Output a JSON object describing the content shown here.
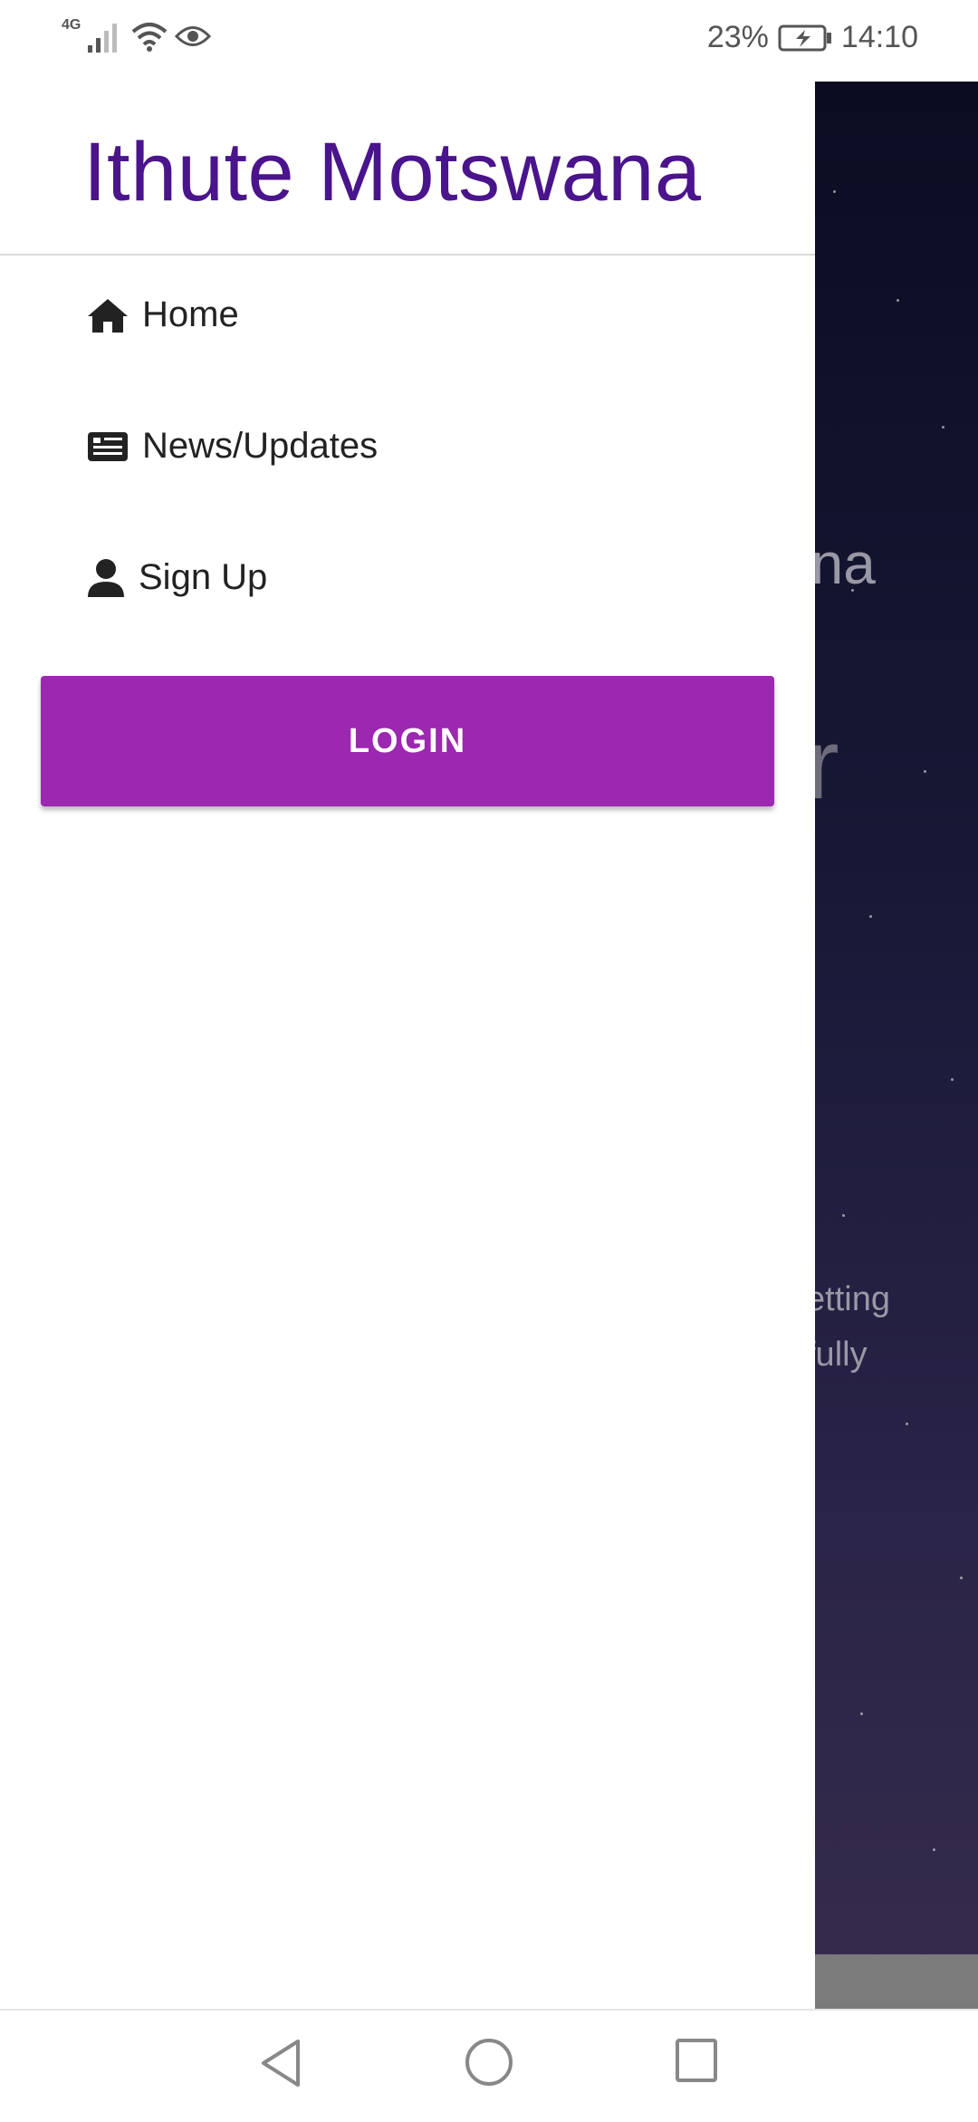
{
  "status_bar": {
    "network": "4G",
    "battery": "23%",
    "time": "14:10"
  },
  "drawer": {
    "title": "Ithute Motswana",
    "items": [
      {
        "label": "Home",
        "icon": "home-icon"
      },
      {
        "label": "News/Updates",
        "icon": "newspaper-icon"
      },
      {
        "label": "Sign Up",
        "icon": "user-icon"
      }
    ],
    "login_label": "LOGIN"
  },
  "background_app": {
    "title_fragment": "ana",
    "big_fragment": "r",
    "line1_fragment": "etting",
    "line2_fragment": "fully"
  },
  "colors": {
    "title": "#4a148c",
    "login_button": "#9c27b0"
  }
}
